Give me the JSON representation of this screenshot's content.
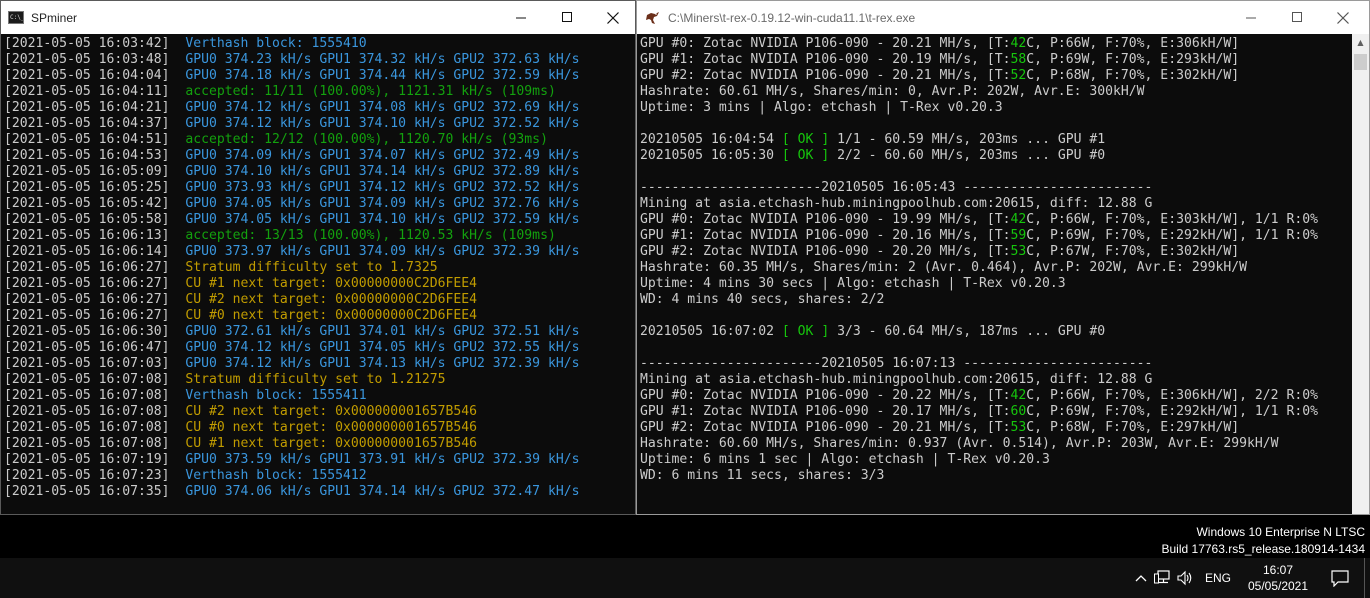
{
  "left_window": {
    "icon_text": "C:\\_",
    "title": "SPminer",
    "lines": [
      {
        "ts": "[2021-05-05 16:03:42]",
        "msg": "Verthash block: 1555410",
        "color": "blue"
      },
      {
        "ts": "[2021-05-05 16:03:48]",
        "msg": "GPU0 374.23 kH/s GPU1 374.32 kH/s GPU2 372.63 kH/s",
        "color": "blue"
      },
      {
        "ts": "[2021-05-05 16:04:04]",
        "msg": "GPU0 374.18 kH/s GPU1 374.44 kH/s GPU2 372.59 kH/s",
        "color": "blue"
      },
      {
        "ts": "[2021-05-05 16:04:11]",
        "msg": "accepted: 11/11 (100.00%), 1121.31 kH/s (109ms)",
        "color": "green"
      },
      {
        "ts": "[2021-05-05 16:04:21]",
        "msg": "GPU0 374.12 kH/s GPU1 374.08 kH/s GPU2 372.69 kH/s",
        "color": "blue"
      },
      {
        "ts": "[2021-05-05 16:04:37]",
        "msg": "GPU0 374.12 kH/s GPU1 374.10 kH/s GPU2 372.52 kH/s",
        "color": "blue"
      },
      {
        "ts": "[2021-05-05 16:04:51]",
        "msg": "accepted: 12/12 (100.00%), 1120.70 kH/s (93ms)",
        "color": "green"
      },
      {
        "ts": "[2021-05-05 16:04:53]",
        "msg": "GPU0 374.09 kH/s GPU1 374.07 kH/s GPU2 372.49 kH/s",
        "color": "blue"
      },
      {
        "ts": "[2021-05-05 16:05:09]",
        "msg": "GPU0 374.10 kH/s GPU1 374.14 kH/s GPU2 372.89 kH/s",
        "color": "blue"
      },
      {
        "ts": "[2021-05-05 16:05:25]",
        "msg": "GPU0 373.93 kH/s GPU1 374.12 kH/s GPU2 372.52 kH/s",
        "color": "blue"
      },
      {
        "ts": "[2021-05-05 16:05:42]",
        "msg": "GPU0 374.05 kH/s GPU1 374.09 kH/s GPU2 372.76 kH/s",
        "color": "blue"
      },
      {
        "ts": "[2021-05-05 16:05:58]",
        "msg": "GPU0 374.05 kH/s GPU1 374.10 kH/s GPU2 372.59 kH/s",
        "color": "blue"
      },
      {
        "ts": "[2021-05-05 16:06:13]",
        "msg": "accepted: 13/13 (100.00%), 1120.53 kH/s (109ms)",
        "color": "green"
      },
      {
        "ts": "[2021-05-05 16:06:14]",
        "msg": "GPU0 373.97 kH/s GPU1 374.09 kH/s GPU2 372.39 kH/s",
        "color": "blue"
      },
      {
        "ts": "[2021-05-05 16:06:27]",
        "msg": "Stratum difficulty set to 1.7325",
        "color": "yellow"
      },
      {
        "ts": "[2021-05-05 16:06:27]",
        "msg": "CU #1 next target: 0x00000000C2D6FEE4",
        "color": "yellow"
      },
      {
        "ts": "[2021-05-05 16:06:27]",
        "msg": "CU #2 next target: 0x00000000C2D6FEE4",
        "color": "yellow"
      },
      {
        "ts": "[2021-05-05 16:06:27]",
        "msg": "CU #0 next target: 0x00000000C2D6FEE4",
        "color": "yellow"
      },
      {
        "ts": "[2021-05-05 16:06:30]",
        "msg": "GPU0 372.61 kH/s GPU1 374.01 kH/s GPU2 372.51 kH/s",
        "color": "blue"
      },
      {
        "ts": "[2021-05-05 16:06:47]",
        "msg": "GPU0 374.12 kH/s GPU1 374.05 kH/s GPU2 372.55 kH/s",
        "color": "blue"
      },
      {
        "ts": "[2021-05-05 16:07:03]",
        "msg": "GPU0 374.12 kH/s GPU1 374.13 kH/s GPU2 372.39 kH/s",
        "color": "blue"
      },
      {
        "ts": "[2021-05-05 16:07:08]",
        "msg": "Stratum difficulty set to 1.21275",
        "color": "yellow"
      },
      {
        "ts": "[2021-05-05 16:07:08]",
        "msg": "Verthash block: 1555411",
        "color": "blue"
      },
      {
        "ts": "[2021-05-05 16:07:08]",
        "msg": "CU #2 next target: 0x000000001657B546",
        "color": "yellow"
      },
      {
        "ts": "[2021-05-05 16:07:08]",
        "msg": "CU #0 next target: 0x000000001657B546",
        "color": "yellow"
      },
      {
        "ts": "[2021-05-05 16:07:08]",
        "msg": "CU #1 next target: 0x000000001657B546",
        "color": "yellow"
      },
      {
        "ts": "[2021-05-05 16:07:19]",
        "msg": "GPU0 373.59 kH/s GPU1 373.91 kH/s GPU2 372.39 kH/s",
        "color": "blue"
      },
      {
        "ts": "[2021-05-05 16:07:23]",
        "msg": "Verthash block: 1555412",
        "color": "blue"
      },
      {
        "ts": "[2021-05-05 16:07:35]",
        "msg": "GPU0 374.06 kH/s GPU1 374.14 kH/s GPU2 372.47 kH/s",
        "color": "blue"
      }
    ]
  },
  "right_window": {
    "title": "C:\\Miners\\t-rex-0.19.12-win-cuda11.1\\t-rex.exe",
    "lines": [
      [
        {
          "t": "GPU #0: Zotac NVIDIA P106-090 - 20.21 MH/s, [T:"
        },
        {
          "t": "42",
          "c": "g"
        },
        {
          "t": "C, P:66W, F:70%, E:306kH/W]"
        }
      ],
      [
        {
          "t": "GPU #1: Zotac NVIDIA P106-090 - 20.19 MH/s, [T:"
        },
        {
          "t": "58",
          "c": "g"
        },
        {
          "t": "C, P:69W, F:70%, E:293kH/W]"
        }
      ],
      [
        {
          "t": "GPU #2: Zotac NVIDIA P106-090 - 20.21 MH/s, [T:"
        },
        {
          "t": "52",
          "c": "g"
        },
        {
          "t": "C, P:68W, F:70%, E:302kH/W]"
        }
      ],
      [
        {
          "t": "Hashrate: 60.61 MH/s, Shares/min: 0, Avr.P: 202W, Avr.E: 300kH/W"
        }
      ],
      [
        {
          "t": "Uptime: 3 mins | Algo: etchash | T-Rex v0.20.3"
        }
      ],
      [],
      [
        {
          "t": "20210505 16:04:54 "
        },
        {
          "t": "[ OK ]",
          "c": "g"
        },
        {
          "t": " 1/1 - 60.59 MH/s, 203ms ... GPU #1"
        }
      ],
      [
        {
          "t": "20210505 16:05:30 "
        },
        {
          "t": "[ OK ]",
          "c": "g"
        },
        {
          "t": " 2/2 - 60.60 MH/s, 203ms ... GPU #0"
        }
      ],
      [],
      [
        {
          "t": "-----------------------20210505 16:05:43 ------------------------"
        }
      ],
      [
        {
          "t": "Mining at asia.etchash-hub.miningpoolhub.com:20615, diff: 12.88 G"
        }
      ],
      [
        {
          "t": "GPU #0: Zotac NVIDIA P106-090 - 19.99 MH/s, [T:"
        },
        {
          "t": "42",
          "c": "g"
        },
        {
          "t": "C, P:66W, F:70%, E:303kH/W], 1/1 R:0%"
        }
      ],
      [
        {
          "t": "GPU #1: Zotac NVIDIA P106-090 - 20.16 MH/s, [T:"
        },
        {
          "t": "59",
          "c": "g"
        },
        {
          "t": "C, P:69W, F:70%, E:292kH/W], 1/1 R:0%"
        }
      ],
      [
        {
          "t": "GPU #2: Zotac NVIDIA P106-090 - 20.20 MH/s, [T:"
        },
        {
          "t": "53",
          "c": "g"
        },
        {
          "t": "C, P:67W, F:70%, E:302kH/W]"
        }
      ],
      [
        {
          "t": "Hashrate: 60.35 MH/s, Shares/min: 2 (Avr. 0.464), Avr.P: 202W, Avr.E: 299kH/W"
        }
      ],
      [
        {
          "t": "Uptime: 4 mins 30 secs | Algo: etchash | T-Rex v0.20.3"
        }
      ],
      [
        {
          "t": "WD: 4 mins 40 secs, shares: 2/2"
        }
      ],
      [],
      [
        {
          "t": "20210505 16:07:02 "
        },
        {
          "t": "[ OK ]",
          "c": "g"
        },
        {
          "t": " 3/3 - 60.64 MH/s, 187ms ... GPU #0"
        }
      ],
      [],
      [
        {
          "t": "-----------------------20210505 16:07:13 ------------------------"
        }
      ],
      [
        {
          "t": "Mining at asia.etchash-hub.miningpoolhub.com:20615, diff: 12.88 G"
        }
      ],
      [
        {
          "t": "GPU #0: Zotac NVIDIA P106-090 - 20.22 MH/s, [T:"
        },
        {
          "t": "42",
          "c": "g"
        },
        {
          "t": "C, P:66W, F:70%, E:306kH/W], 2/2 R:0%"
        }
      ],
      [
        {
          "t": "GPU #1: Zotac NVIDIA P106-090 - 20.17 MH/s, [T:"
        },
        {
          "t": "60",
          "c": "g"
        },
        {
          "t": "C, P:69W, F:70%, E:292kH/W], 1/1 R:0%"
        }
      ],
      [
        {
          "t": "GPU #2: Zotac NVIDIA P106-090 - 20.21 MH/s, [T:"
        },
        {
          "t": "53",
          "c": "g"
        },
        {
          "t": "C, P:68W, F:70%, E:297kH/W]"
        }
      ],
      [
        {
          "t": "Hashrate: 60.60 MH/s, Shares/min: 0.937 (Avr. 0.514), Avr.P: 203W, Avr.E: 299kH/W"
        }
      ],
      [
        {
          "t": "Uptime: 6 mins 1 sec | Algo: etchash | T-Rex v0.20.3"
        }
      ],
      [
        {
          "t": "WD: 6 mins 11 secs, shares: 3/3"
        }
      ]
    ]
  },
  "watermark": {
    "line1": "Windows 10 Enterprise N LTSC",
    "line2": "Build 17763.rs5_release.180914-1434"
  },
  "taskbar": {
    "language": "ENG",
    "time": "16:07",
    "date": "05/05/2021",
    "tray_icons": [
      "chevron-up-icon",
      "network-icon",
      "volume-icon",
      "notification-icon"
    ]
  },
  "colors": {
    "console_bg": "#0c0c0c",
    "console_text": "#cccccc",
    "blue": "#3a96dd",
    "green": "#13a10e",
    "yellow": "#c19c00",
    "bright_green": "#16c60c"
  }
}
